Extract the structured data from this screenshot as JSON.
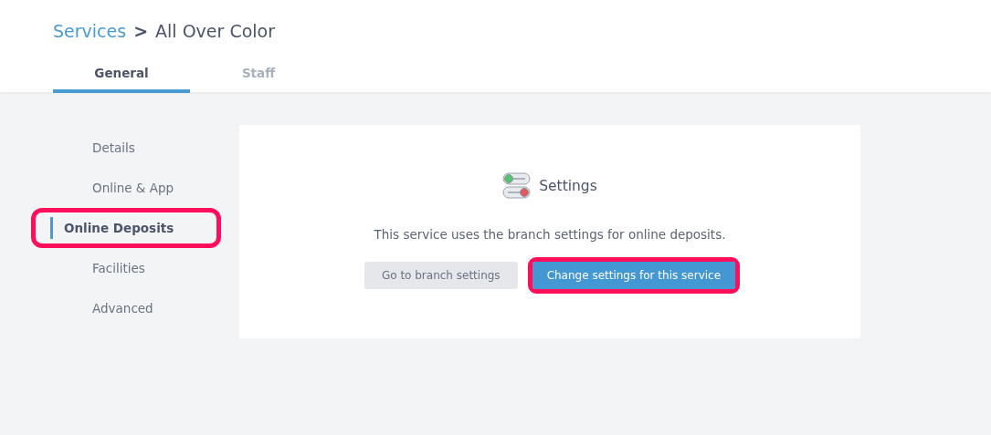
{
  "breadcrumb": {
    "parent": "Services",
    "separator": ">",
    "current": "All Over Color"
  },
  "tabs": [
    {
      "label": "General",
      "selected": true
    },
    {
      "label": "Staff",
      "selected": false
    }
  ],
  "sidebar": {
    "items": [
      {
        "label": "Details",
        "selected": false,
        "highlighted": false
      },
      {
        "label": "Online & App",
        "selected": false,
        "highlighted": false
      },
      {
        "label": "Online Deposits",
        "selected": true,
        "highlighted": true
      },
      {
        "label": "Facilities",
        "selected": false,
        "highlighted": false
      },
      {
        "label": "Advanced",
        "selected": false,
        "highlighted": false
      }
    ]
  },
  "card": {
    "title": "Settings",
    "message": "This service uses the branch settings for online deposits.",
    "buttons": [
      {
        "label": "Go to branch settings",
        "kind": "secondary",
        "highlighted": false
      },
      {
        "label": "Change settings for this service",
        "kind": "primary",
        "highlighted": true
      }
    ]
  }
}
